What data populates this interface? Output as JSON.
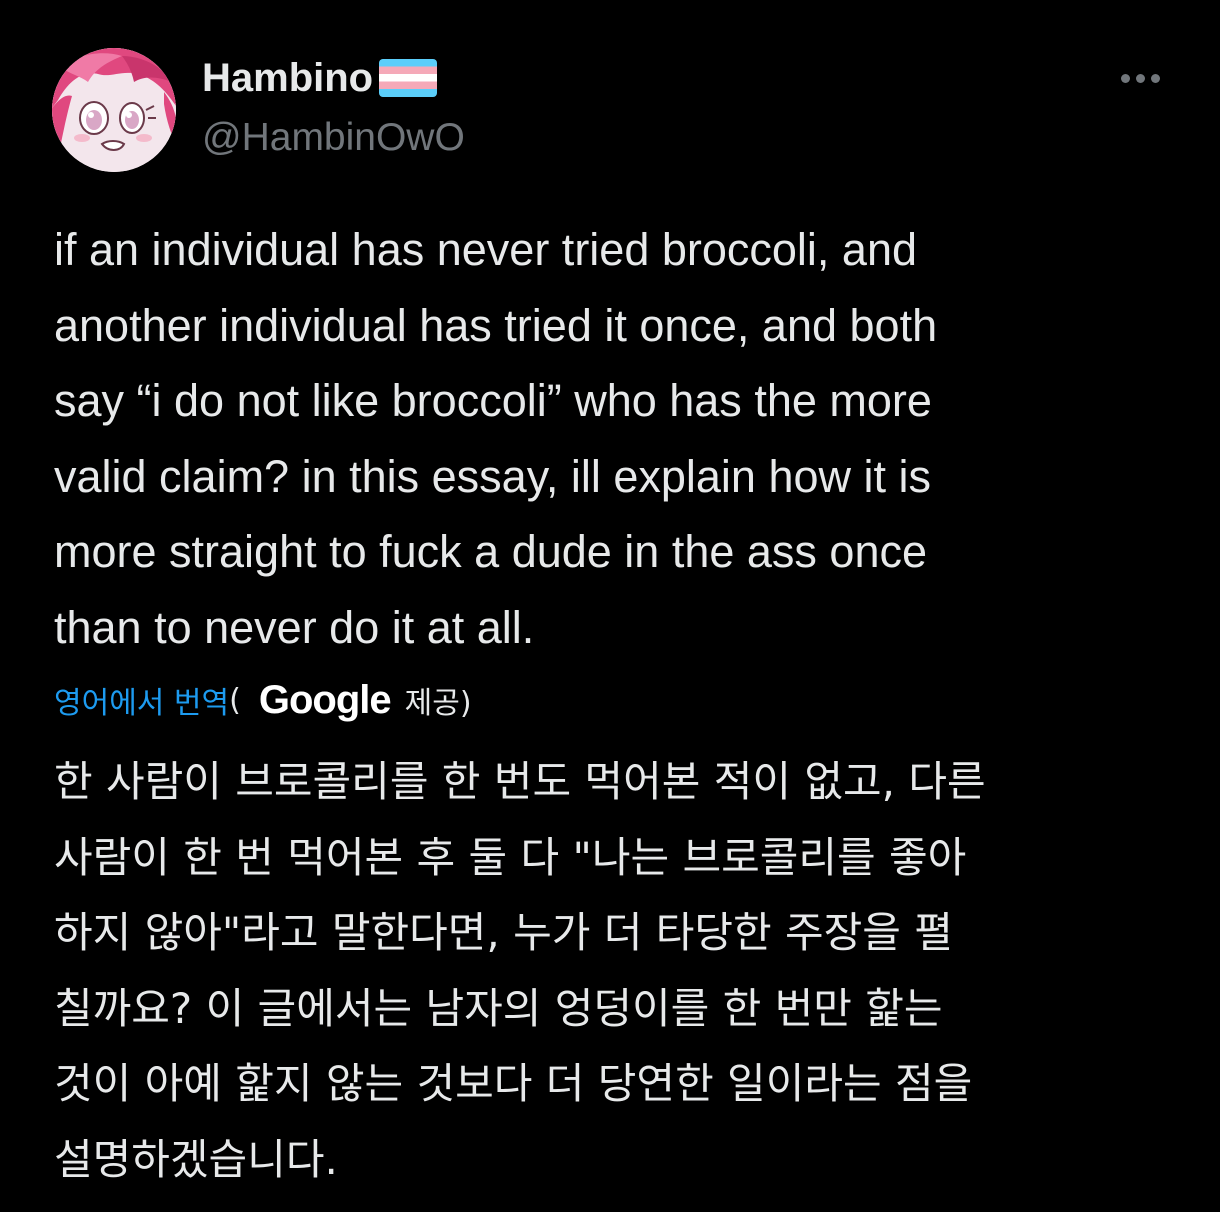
{
  "author": {
    "display_name": "Hambino",
    "handle": "@HambinOwO",
    "avatar_icon": "anime-avatar-icon",
    "flag_icon": "transgender-flag-icon"
  },
  "more_icon": "more-options-icon",
  "tweet": {
    "text": "if an individual has never tried broccoli, and\nanother individual has tried it once, and both\nsay “i do not like broccoli” who has the more\nvalid claim? in this essay, ill explain how it is\nmore straight to fuck a dude in the ass once\nthan to never do it at all."
  },
  "translation": {
    "link_label": "영어에서 번역",
    "open_paren": "(",
    "provider": "Google",
    "provided_by": "제공)",
    "text": "한 사람이 브로콜리를 한 번도 먹어본 적이 없고, 다른\n사람이 한 번 먹어본 후 둘 다 \"나는 브로콜리를 좋아\n하지 않아\"라고 말한다면, 누가 더 타당한 주장을 펼\n칠까요? 이 글에서는 남자의 엉덩이를 한 번만 핥는\n것이 아예 핥지 않는 것보다 더 당연한 일이라는 점을\n설명하겠습니다."
  },
  "colors": {
    "background": "#000000",
    "text": "#e7e9ea",
    "secondary": "#71767b",
    "link": "#1d9bf0",
    "flag_blue": "#5bcefa",
    "flag_pink": "#f5a9b8",
    "flag_white": "#ffffff"
  }
}
